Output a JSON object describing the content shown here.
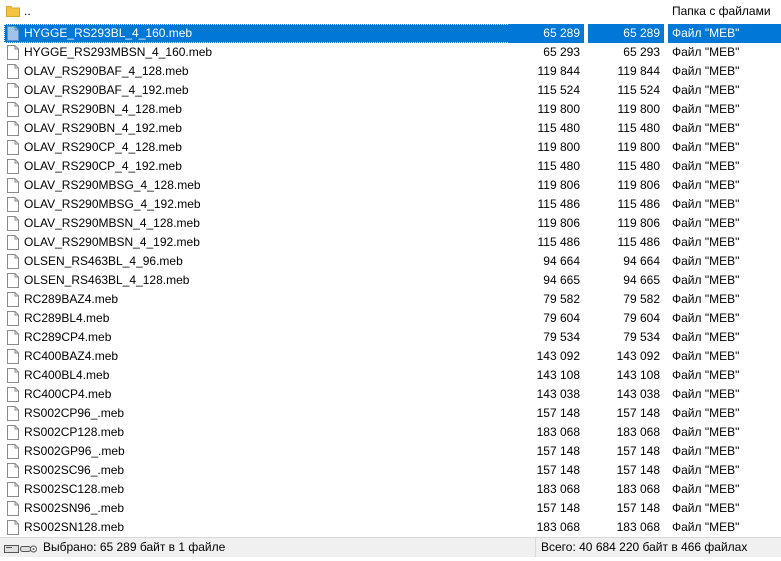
{
  "parent_entry": {
    "name": "..",
    "type": "Папка с файлами"
  },
  "files": [
    {
      "name": "HYGGE_RS293BL_4_160.meb",
      "size": "65 289",
      "packed": "65 289",
      "type": "Файл \"MEB\"",
      "selected": true
    },
    {
      "name": "HYGGE_RS293MBSN_4_160.meb",
      "size": "65 293",
      "packed": "65 293",
      "type": "Файл \"MEB\""
    },
    {
      "name": "OLAV_RS290BAF_4_128.meb",
      "size": "119 844",
      "packed": "119 844",
      "type": "Файл \"MEB\""
    },
    {
      "name": "OLAV_RS290BAF_4_192.meb",
      "size": "115 524",
      "packed": "115 524",
      "type": "Файл \"MEB\""
    },
    {
      "name": "OLAV_RS290BN_4_128.meb",
      "size": "119 800",
      "packed": "119 800",
      "type": "Файл \"MEB\""
    },
    {
      "name": "OLAV_RS290BN_4_192.meb",
      "size": "115 480",
      "packed": "115 480",
      "type": "Файл \"MEB\""
    },
    {
      "name": "OLAV_RS290CP_4_128.meb",
      "size": "119 800",
      "packed": "119 800",
      "type": "Файл \"MEB\""
    },
    {
      "name": "OLAV_RS290CP_4_192.meb",
      "size": "115 480",
      "packed": "115 480",
      "type": "Файл \"MEB\""
    },
    {
      "name": "OLAV_RS290MBSG_4_128.meb",
      "size": "119 806",
      "packed": "119 806",
      "type": "Файл \"MEB\""
    },
    {
      "name": "OLAV_RS290MBSG_4_192.meb",
      "size": "115 486",
      "packed": "115 486",
      "type": "Файл \"MEB\""
    },
    {
      "name": "OLAV_RS290MBSN_4_128.meb",
      "size": "119 806",
      "packed": "119 806",
      "type": "Файл \"MEB\""
    },
    {
      "name": "OLAV_RS290MBSN_4_192.meb",
      "size": "115 486",
      "packed": "115 486",
      "type": "Файл \"MEB\""
    },
    {
      "name": "OLSEN_RS463BL_4_96.meb",
      "size": "94 664",
      "packed": "94 664",
      "type": "Файл \"MEB\""
    },
    {
      "name": "OLSEN_RS463BL_4_128.meb",
      "size": "94 665",
      "packed": "94 665",
      "type": "Файл \"MEB\""
    },
    {
      "name": "RC289BAZ4.meb",
      "size": "79 582",
      "packed": "79 582",
      "type": "Файл \"MEB\""
    },
    {
      "name": "RC289BL4.meb",
      "size": "79 604",
      "packed": "79 604",
      "type": "Файл \"MEB\""
    },
    {
      "name": "RC289CP4.meb",
      "size": "79 534",
      "packed": "79 534",
      "type": "Файл \"MEB\""
    },
    {
      "name": "RC400BAZ4.meb",
      "size": "143 092",
      "packed": "143 092",
      "type": "Файл \"MEB\""
    },
    {
      "name": "RC400BL4.meb",
      "size": "143 108",
      "packed": "143 108",
      "type": "Файл \"MEB\""
    },
    {
      "name": "RC400CP4.meb",
      "size": "143 038",
      "packed": "143 038",
      "type": "Файл \"MEB\""
    },
    {
      "name": "RS002CP96_.meb",
      "size": "157 148",
      "packed": "157 148",
      "type": "Файл \"MEB\""
    },
    {
      "name": "RS002CP128.meb",
      "size": "183 068",
      "packed": "183 068",
      "type": "Файл \"MEB\""
    },
    {
      "name": "RS002GP96_.meb",
      "size": "157 148",
      "packed": "157 148",
      "type": "Файл \"MEB\""
    },
    {
      "name": "RS002SC96_.meb",
      "size": "157 148",
      "packed": "157 148",
      "type": "Файл \"MEB\""
    },
    {
      "name": "RS002SC128.meb",
      "size": "183 068",
      "packed": "183 068",
      "type": "Файл \"MEB\""
    },
    {
      "name": "RS002SN96_.meb",
      "size": "157 148",
      "packed": "157 148",
      "type": "Файл \"MEB\""
    },
    {
      "name": "RS002SN128.meb",
      "size": "183 068",
      "packed": "183 068",
      "type": "Файл \"MEB\""
    }
  ],
  "status": {
    "selected_text": "Выбрано: 65 289 байт в 1 файле",
    "total_text": "Всего: 40 684 220 байт в 466 файлах"
  },
  "icons": {
    "folder": "folder-icon",
    "file": "file-icon",
    "drive": "drive-icon"
  },
  "colors": {
    "selection": "#0078d7",
    "folder": "#f5c242",
    "statusbar": "#f0f0f0"
  }
}
